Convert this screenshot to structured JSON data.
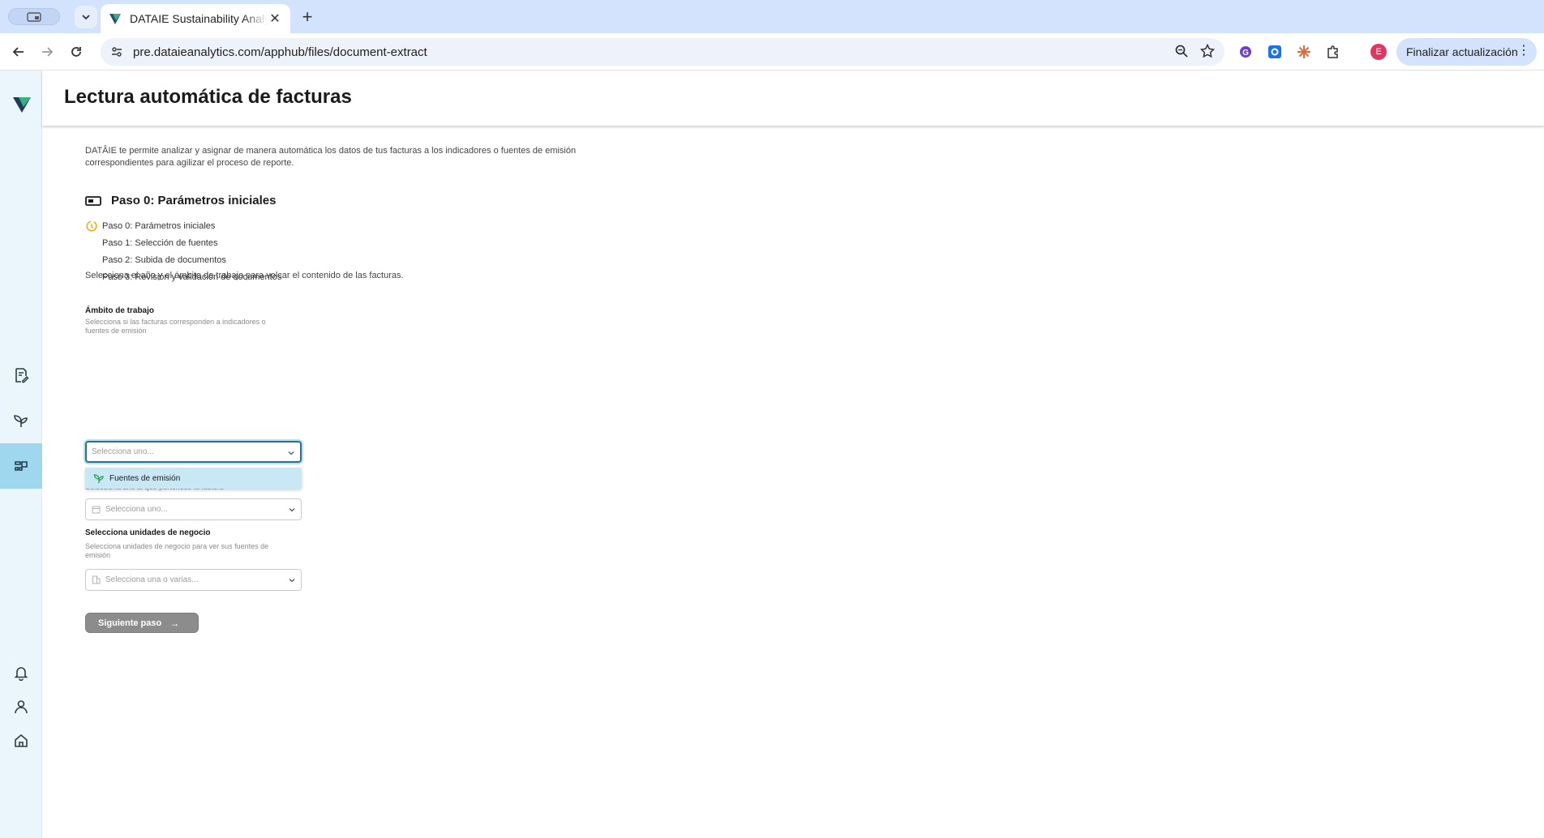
{
  "browser": {
    "tab_title": "DATAIE Sustainability Analytics",
    "url": "pre.dataieanalytics.com/apphub/files/document-extract",
    "profile_initial": "E",
    "update_label": "Finalizar actualización"
  },
  "header": {
    "title": "Lectura automática de facturas"
  },
  "intro": {
    "text": "DATÂIE te permite analizar y asignar de manera automática los datos de tus facturas a los indicadores o fuentes de emisión correspondientes para agilizar el proceso de reporte."
  },
  "step_heading": "Paso 0: Parámetros iniciales",
  "steps": [
    {
      "label": "Paso 0: Parámetros iniciales",
      "status": "in-progress"
    },
    {
      "label": "Paso 1: Selección de fuentes",
      "status": "pending"
    },
    {
      "label": "Paso 2: Subida de documentos",
      "status": "pending"
    },
    {
      "label": "Paso 3: Revisión y validación de documentos",
      "status": "pending"
    }
  ],
  "instruction": "Selecciona el año y el ámbito de trabajo para volcar el contenido de las facturas.",
  "form": {
    "scope": {
      "label": "Ámbito de trabajo",
      "help": "Selecciona si las facturas corresponden a indicadores o fuentes de emisión",
      "placeholder": "Selecciona uno..."
    },
    "scope_options": [
      {
        "label": "Fuentes de emisión",
        "icon": "emission-sources-icon"
      }
    ],
    "year": {
      "help": "Selecciona año al que pertenece la factura",
      "placeholder": "Selecciona uno..."
    },
    "business_units": {
      "label": "Selecciona unidades de negocio",
      "help": "Selecciona unidades de negocio para ver sus fuentes de emisión",
      "placeholder": "Selecciona una o varias..."
    },
    "next_button": "Siguiente paso"
  },
  "colors": {
    "sidebar_bg": "#eaf6fb",
    "sidebar_active": "#9fd8ee",
    "accent": "#2e6f8f",
    "step_in_progress": "#f0a500",
    "disabled_button": "#8c8c8c"
  }
}
